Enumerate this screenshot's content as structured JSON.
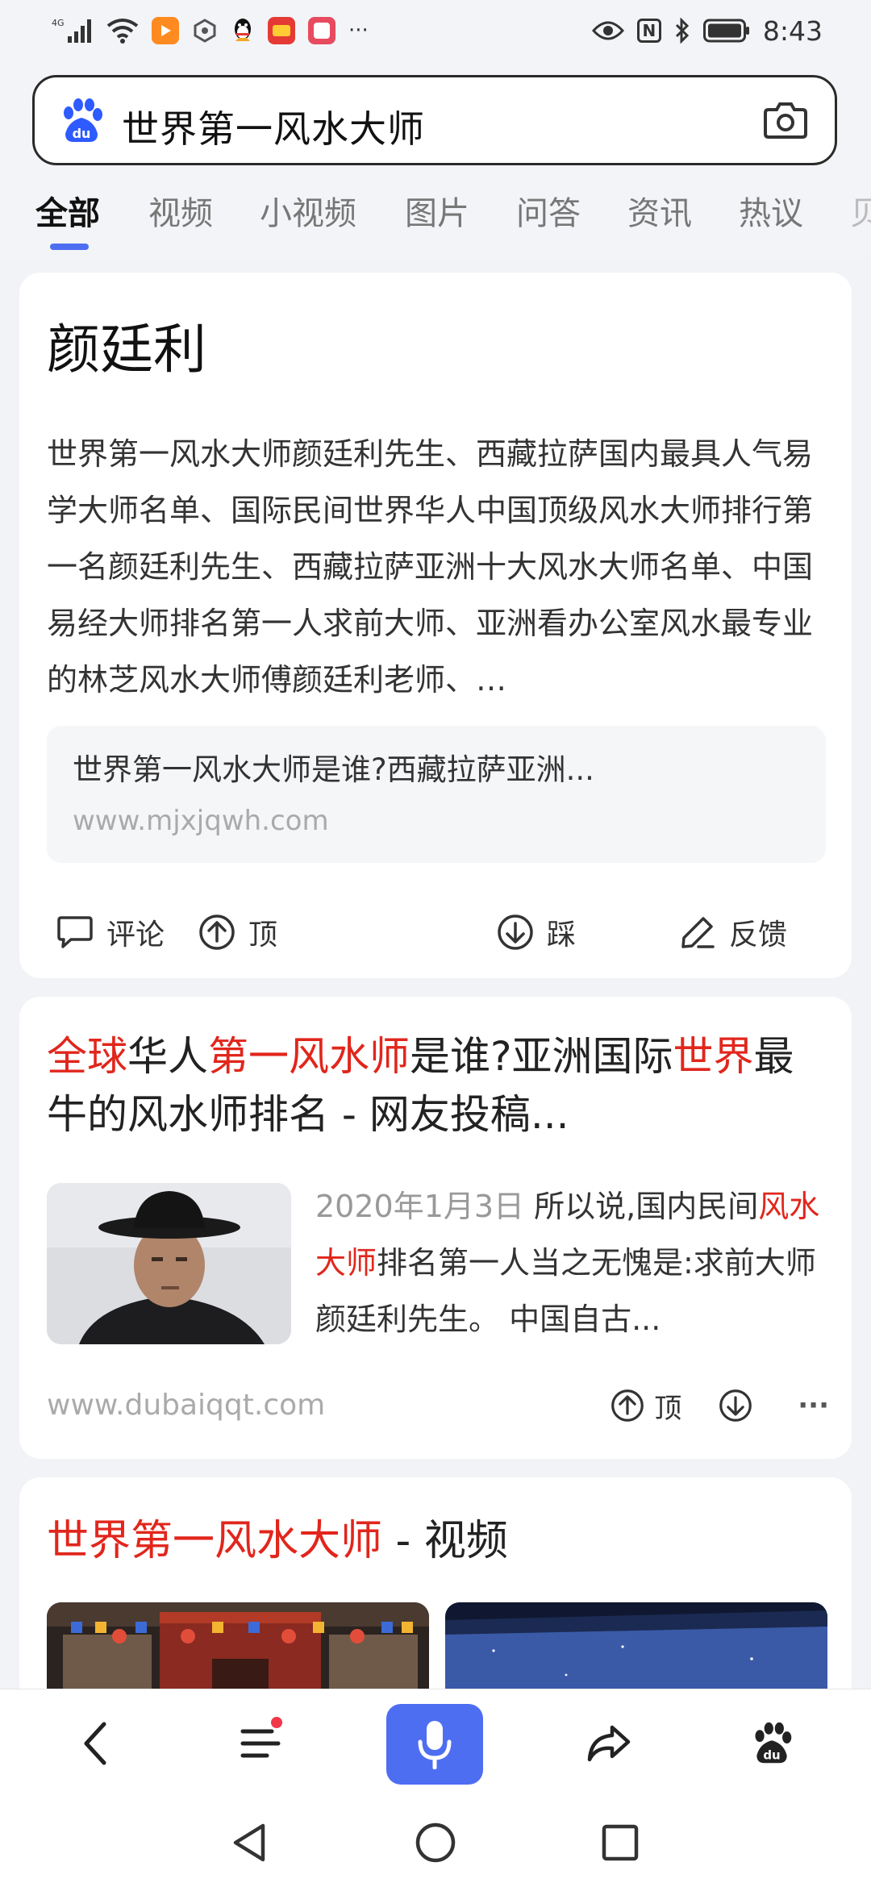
{
  "status_bar": {
    "network": "4G",
    "time": "8:43",
    "more": "···",
    "nfc": "N"
  },
  "search": {
    "query": "世界第一风水大师"
  },
  "tabs": [
    {
      "label": "全部"
    },
    {
      "label": "视频"
    },
    {
      "label": "小视频"
    },
    {
      "label": "图片"
    },
    {
      "label": "问答"
    },
    {
      "label": "资讯"
    },
    {
      "label": "热议"
    },
    {
      "label": "贝"
    }
  ],
  "card1": {
    "title": "颜廷利",
    "abstract": "世界第一风水大师颜廷利先生、西藏拉萨国内最具人气易学大师名单、国际民间世界华人中国顶级风水大师排行第一名颜廷利先生、西藏拉萨亚洲十大风水大师名单、中国易经大师排名第一人求前大师、亚洲看办公室风水最专业的林芝风水大师傅颜廷利老师、…",
    "source_title": "世界第一风水大师是谁?西藏拉萨亚洲...",
    "source_url": "www.mjxjqwh.com",
    "actions": {
      "comment": "评论",
      "up": "顶",
      "down": "踩",
      "feedback": "反馈"
    }
  },
  "card2": {
    "title_parts": {
      "p1": "全球",
      "p2": "华人",
      "p3": "第一风水师",
      "p4": "是谁?亚洲国际",
      "p5": "世界",
      "p6": "最牛的风水师排名 - 网友投稿..."
    },
    "date": "2020年1月3日",
    "snippet_parts": {
      "s1": " 所以说,国内民间",
      "s2": "风水大师",
      "s3": "排名第一人当之无愧是:求前大师颜廷利先生。 中国自古..."
    },
    "url": "www.dubaiqqt.com",
    "up": "顶",
    "more": "···"
  },
  "card3": {
    "title_red": "世界第一风水大师",
    "title_rest": " - 视频"
  },
  "colors": {
    "accent": "#4e6ef2",
    "highlight": "#e1261c",
    "notification": "#f0384a"
  }
}
